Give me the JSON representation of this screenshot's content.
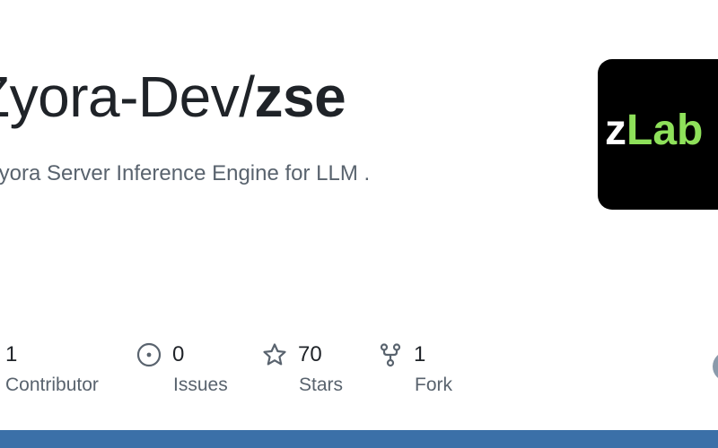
{
  "repo": {
    "owner": "Zyora-Dev/",
    "name": "zse",
    "description": "Zyora Server Inference Engine for LLM ."
  },
  "logo": {
    "text_z": "z",
    "text_lab": "Lab"
  },
  "stats": [
    {
      "value": "1",
      "label": "Contributor",
      "icon": "people-icon"
    },
    {
      "value": "0",
      "label": "Issues",
      "icon": "issue-icon"
    },
    {
      "value": "70",
      "label": "Stars",
      "icon": "star-icon"
    },
    {
      "value": "1",
      "label": "Fork",
      "icon": "fork-icon"
    }
  ],
  "colors": {
    "accent_bar": "#3b70a8",
    "logo_green": "#8ee05a",
    "text_primary": "#1f2328",
    "text_muted": "#59636e"
  }
}
